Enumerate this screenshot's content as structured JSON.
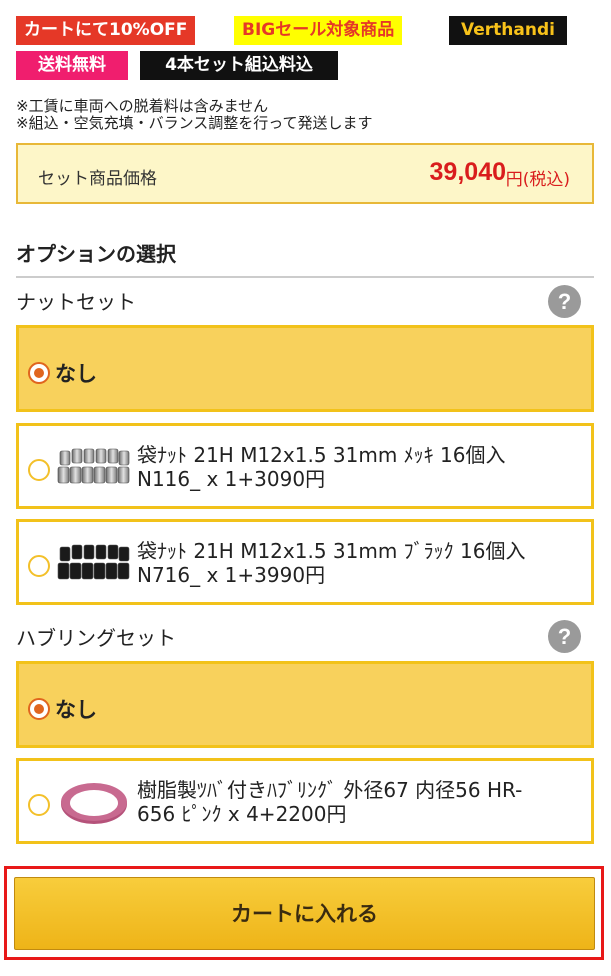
{
  "tags": {
    "discount": "カートにて10%OFF",
    "big_sale": "BIGセール対象商品",
    "brand": "Verthandi",
    "free_shipping": "送料無料",
    "set_assembly": "4本セット組込料込"
  },
  "notes": {
    "line1": "※工賃に車両への脱着料は含みません",
    "line2": "※組込・空気充填・バランス調整を行って発送します"
  },
  "price": {
    "label": "セット商品価格",
    "value": "39,040",
    "unit": "円(税込)"
  },
  "options": {
    "title": "オプションの選択",
    "nut_set": {
      "label": "ナットセット",
      "help": "?",
      "none_label": "なし",
      "items": [
        {
          "line1": "袋ﾅｯﾄ 21H M12x1.5 31mm ﾒｯｷ 16個入",
          "line2": "N116_ x 1+3090円",
          "icon": "chrome-lug-nuts-image"
        },
        {
          "line1": "袋ﾅｯﾄ 21H M12x1.5 31mm ﾌﾞﾗｯｸ 16個入",
          "line2": "N716_ x 1+3990円",
          "icon": "black-lug-nuts-image"
        }
      ]
    },
    "hub_ring_set": {
      "label": "ハブリングセット",
      "help": "?",
      "none_label": "なし",
      "items": [
        {
          "line1": "樹脂製ﾂﾊﾞ付きﾊﾌﾞﾘﾝｸﾞ 外径67 内径56 HR-",
          "line2": "656 ﾋﾟﾝｸ x 4+2200円",
          "icon": "pink-hub-ring-image"
        }
      ]
    }
  },
  "cart": {
    "button_label": "カートに入れる"
  },
  "colors": {
    "accent": "#f2c21a",
    "selected_bg": "#f8d15c",
    "price_red": "#d91d1d",
    "cart_frame": "#e81818"
  }
}
